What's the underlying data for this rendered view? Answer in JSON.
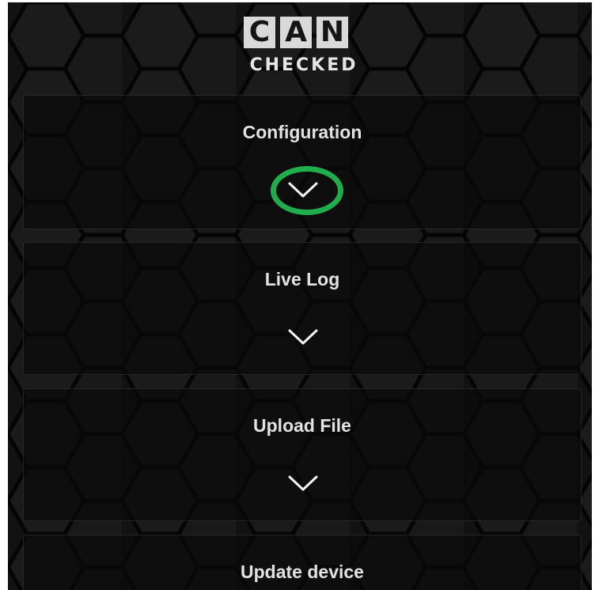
{
  "brand": {
    "letters": [
      "C",
      "A",
      "N"
    ],
    "subtitle": "CHECKED"
  },
  "panels": [
    {
      "label": "Configuration",
      "icon": "chevron-down-icon",
      "highlighted": true
    },
    {
      "label": "Live Log",
      "icon": "chevron-down-icon",
      "highlighted": false
    },
    {
      "label": "Upload File",
      "icon": "chevron-down-icon",
      "highlighted": false
    },
    {
      "label": "Update device",
      "icon": "chevron-down-icon",
      "highlighted": false
    }
  ],
  "colors": {
    "background": "#0e0e0e",
    "panel_text": "#e2e2e2",
    "highlight": "#1fae4b",
    "logo_tile": "#d9d9d9"
  }
}
